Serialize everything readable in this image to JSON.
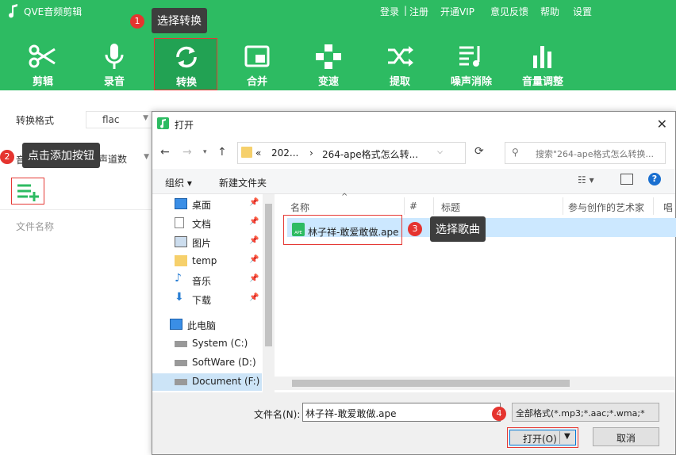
{
  "app": {
    "title": "QVE音频剪辑",
    "links": [
      "登录",
      "|",
      "注册",
      "开通VIP",
      "意见反馈",
      "帮助",
      "设置"
    ]
  },
  "tools": [
    {
      "label": "剪辑",
      "icon": "scissors-icon"
    },
    {
      "label": "录音",
      "icon": "microphone-icon"
    },
    {
      "label": "转换",
      "icon": "convert-icon"
    },
    {
      "label": "合并",
      "icon": "merge-icon"
    },
    {
      "label": "变速",
      "icon": "speed-icon"
    },
    {
      "label": "提取",
      "icon": "extract-icon"
    },
    {
      "label": "噪声消除",
      "icon": "noise-icon"
    },
    {
      "label": "音量调整",
      "icon": "volume-icon"
    }
  ],
  "left": {
    "format_label": "转换格式",
    "format_value": "flac",
    "channel_label": "音",
    "channel_value": "声道数",
    "file_name_col": "文件名称"
  },
  "callouts": {
    "c1": "选择转换",
    "c2": "点击添加按钮",
    "c3": "选择歌曲",
    "n1": "1",
    "n2": "2",
    "n3": "3",
    "n4": "4"
  },
  "dialog": {
    "title": "打开",
    "path": {
      "p1": "«",
      "p2": "202...",
      "p3": "›",
      "p4": "264-ape格式怎么转..."
    },
    "search_placeholder": "搜索\"264-ape格式怎么转换...",
    "organize": "组织 ▾",
    "new_folder": "新建文件夹",
    "nav_items": [
      {
        "label": "桌面",
        "icon": "desktop-icon"
      },
      {
        "label": "文档",
        "icon": "document-icon"
      },
      {
        "label": "图片",
        "icon": "picture-icon"
      },
      {
        "label": "temp",
        "icon": "folder-icon"
      },
      {
        "label": "音乐",
        "icon": "music-icon"
      },
      {
        "label": "下载",
        "icon": "download-icon"
      },
      {
        "label": "此电脑",
        "icon": "computer-icon"
      },
      {
        "label": "System (C:)",
        "icon": "drive-icon"
      },
      {
        "label": "SoftWare (D:)",
        "icon": "drive-icon"
      },
      {
        "label": "Document (F:)",
        "icon": "drive-icon"
      }
    ],
    "columns": [
      "名称",
      "#",
      "标题",
      "参与创作的艺术家",
      "唱"
    ],
    "file": {
      "name": "林子祥-敢爱敢做.ape",
      "icon_text": "APE"
    },
    "filename_label": "文件名(N):",
    "filename_value": "林子祥-敢爱敢做.ape",
    "filetype": "全部格式(*.mp3;*.aac;*.wma;*",
    "open_label": "打开(O)",
    "cancel_label": "取消"
  }
}
